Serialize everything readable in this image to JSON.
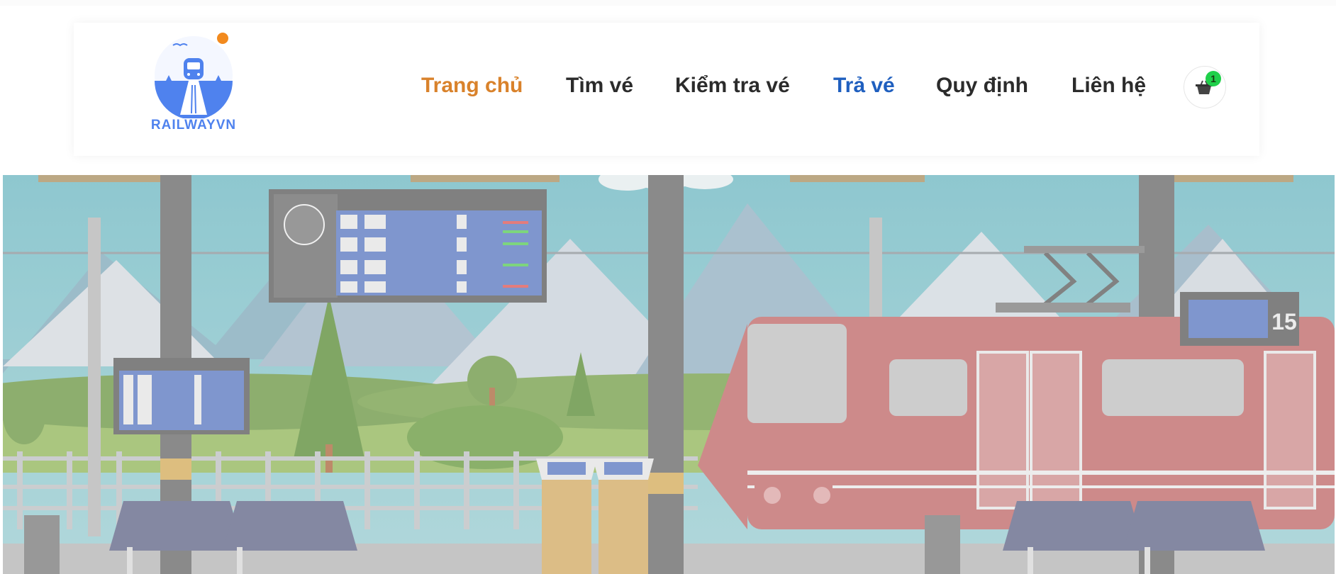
{
  "brand": {
    "name": "RAILWAYVN",
    "accent": "#4f82ee",
    "sun": "#f28a1e"
  },
  "nav": {
    "items": [
      {
        "label": "Trang chủ",
        "color": "#d9822b"
      },
      {
        "label": "Tìm vé",
        "color": "#2b2b2b"
      },
      {
        "label": "Kiểm tra vé",
        "color": "#2b2b2b"
      },
      {
        "label": "Trả vé",
        "color": "#1f5fbf"
      },
      {
        "label": "Quy định",
        "color": "#2b2b2b"
      },
      {
        "label": "Liên hệ",
        "color": "#2b2b2b"
      }
    ]
  },
  "cart": {
    "icon": "shopping-basket-icon",
    "count": "1",
    "badge_color": "#1fd04a"
  },
  "hero": {
    "icon": "train-station-illustration",
    "platform_number": "15"
  }
}
